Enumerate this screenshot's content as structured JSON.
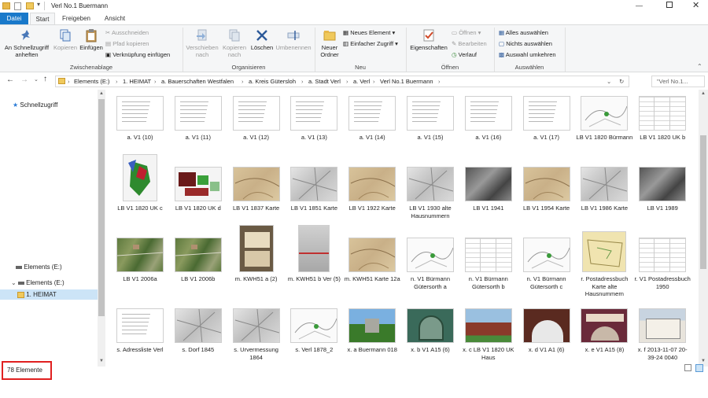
{
  "window": {
    "title": "Verl No.1 Buermann",
    "controls": [
      "minimize-icon",
      "maximize-icon",
      "close-icon"
    ]
  },
  "tabs": [
    {
      "label": "Datei"
    },
    {
      "label": "Start"
    },
    {
      "label": "Freigeben"
    },
    {
      "label": "Ansicht"
    }
  ],
  "ribbon": {
    "clipboard": {
      "pin_label": "An Schnellzugriff anheften",
      "copy_label": "Kopieren",
      "paste_label": "Einfügen",
      "cut_label": "Ausschneiden",
      "copy_path_label": "Pfad kopieren",
      "paste_shortcut_label": "Verknüpfung einfügen",
      "group_label": "Zwischenablage"
    },
    "organize": {
      "move_to_label": "Verschieben nach",
      "copy_to_label": "Kopieren nach",
      "delete_label": "Löschen",
      "rename_label": "Umbenennen",
      "group_label": "Organisieren"
    },
    "new": {
      "new_folder_label": "Neuer Ordner",
      "new_item_label": "Neues Element",
      "easy_access_label": "Einfacher Zugriff",
      "group_label": "Neu"
    },
    "open": {
      "properties_label": "Eigenschaften",
      "open_label": "Öffnen",
      "edit_label": "Bearbeiten",
      "history_label": "Verlauf",
      "group_label": "Öffnen"
    },
    "select": {
      "select_all_label": "Alles auswählen",
      "select_none_label": "Nichts auswählen",
      "invert_label": "Auswahl umkehren",
      "group_label": "Auswählen"
    }
  },
  "address": {
    "crumbs": [
      "Elements (E:)",
      "1. HEIMAT",
      "a. Bauerschaften Westfalen",
      "a. Kreis Gütersloh",
      "a. Stadt Verl",
      "a. Verl",
      "Verl No.1 Buermann"
    ],
    "search_placeholder": "\"Verl No.1..."
  },
  "nav": {
    "quick_access": "Schnellzugriff",
    "drive1": "Elements (E:)",
    "drive2": "Elements (E:)",
    "folder": "1. HEIMAT"
  },
  "files": [
    {
      "name": "a. V1 (10)",
      "kind": "doc"
    },
    {
      "name": "a. V1 (11)",
      "kind": "doc"
    },
    {
      "name": "a. V1 (12)",
      "kind": "doc"
    },
    {
      "name": "a. V1 (13)",
      "kind": "doc"
    },
    {
      "name": "a. V1 (14)",
      "kind": "doc"
    },
    {
      "name": "a. V1 (15)",
      "kind": "doc"
    },
    {
      "name": "a. V1 (16)",
      "kind": "doc"
    },
    {
      "name": "a. V1 (17)",
      "kind": "doc"
    },
    {
      "name": "LB V1 1820 Bürmann",
      "kind": "mapwhite"
    },
    {
      "name": "LB V1 1820 UK b",
      "kind": "table"
    },
    {
      "name": "LB V1 1820 UK c",
      "kind": "mapcolor"
    },
    {
      "name": "LB V1 1820 UK d",
      "kind": "mapcolor2"
    },
    {
      "name": "LB V1 1837 Karte",
      "kind": "mapold"
    },
    {
      "name": "LB V1 1851 Karte",
      "kind": "mapgrey"
    },
    {
      "name": "LB V1 1922 Karte",
      "kind": "mapold"
    },
    {
      "name": "LB V1 1930 alte Hausnummern",
      "kind": "mapgrey"
    },
    {
      "name": "LB V1 1941",
      "kind": "aerial"
    },
    {
      "name": "LB V1 1954 Karte",
      "kind": "mapold"
    },
    {
      "name": "LB V1 1986 Karte",
      "kind": "mapgrey"
    },
    {
      "name": "LB V1 1989",
      "kind": "aerial"
    },
    {
      "name": "LB V1 2006a",
      "kind": "satellite"
    },
    {
      "name": "LB V1 2006b",
      "kind": "satellite"
    },
    {
      "name": "m. KWH51 a (2)",
      "kind": "ledger"
    },
    {
      "name": "m. KWH51 b Ver (5)",
      "kind": "ledgergrey"
    },
    {
      "name": "m. KWH51 Karte 12a",
      "kind": "mapold"
    },
    {
      "name": "n. V1 Bürmann Gütersorth a",
      "kind": "mapwhite"
    },
    {
      "name": "n. V1 Bürmann Gütersorth b",
      "kind": "table"
    },
    {
      "name": "n. V1 Bürmann Gütersorth c",
      "kind": "mapwhite"
    },
    {
      "name": "r. Postadressbuch Karte alte Hausnummern",
      "kind": "mapyellow"
    },
    {
      "name": "r. V1 Postadressbuch 1950",
      "kind": "table"
    },
    {
      "name": "s. Adressliste Verl",
      "kind": "doc"
    },
    {
      "name": "s. Dorf 1845",
      "kind": "mapgrey"
    },
    {
      "name": "s. Urvermessung 1864",
      "kind": "mapgrey"
    },
    {
      "name": "s. Verl 1878_2",
      "kind": "mapwhite"
    },
    {
      "name": "x. a Buermann 018",
      "kind": "photo"
    },
    {
      "name": "x. b V1 A15 (6)",
      "kind": "photo2"
    },
    {
      "name": "x. c LB V1 1820 UK Haus",
      "kind": "photo3"
    },
    {
      "name": "x. d V1 A1 (6)",
      "kind": "photo4"
    },
    {
      "name": "x. e V1 A15 (8)",
      "kind": "photo5"
    },
    {
      "name": "x. f 2013-11-07 20-39-24 0040",
      "kind": "photo6"
    }
  ],
  "status": {
    "item_count": "78 Elemente",
    "highlight_color": "#e02020"
  },
  "colors": {
    "accent": "#1979ca",
    "ribbon_bg": "#f5f6f7"
  }
}
